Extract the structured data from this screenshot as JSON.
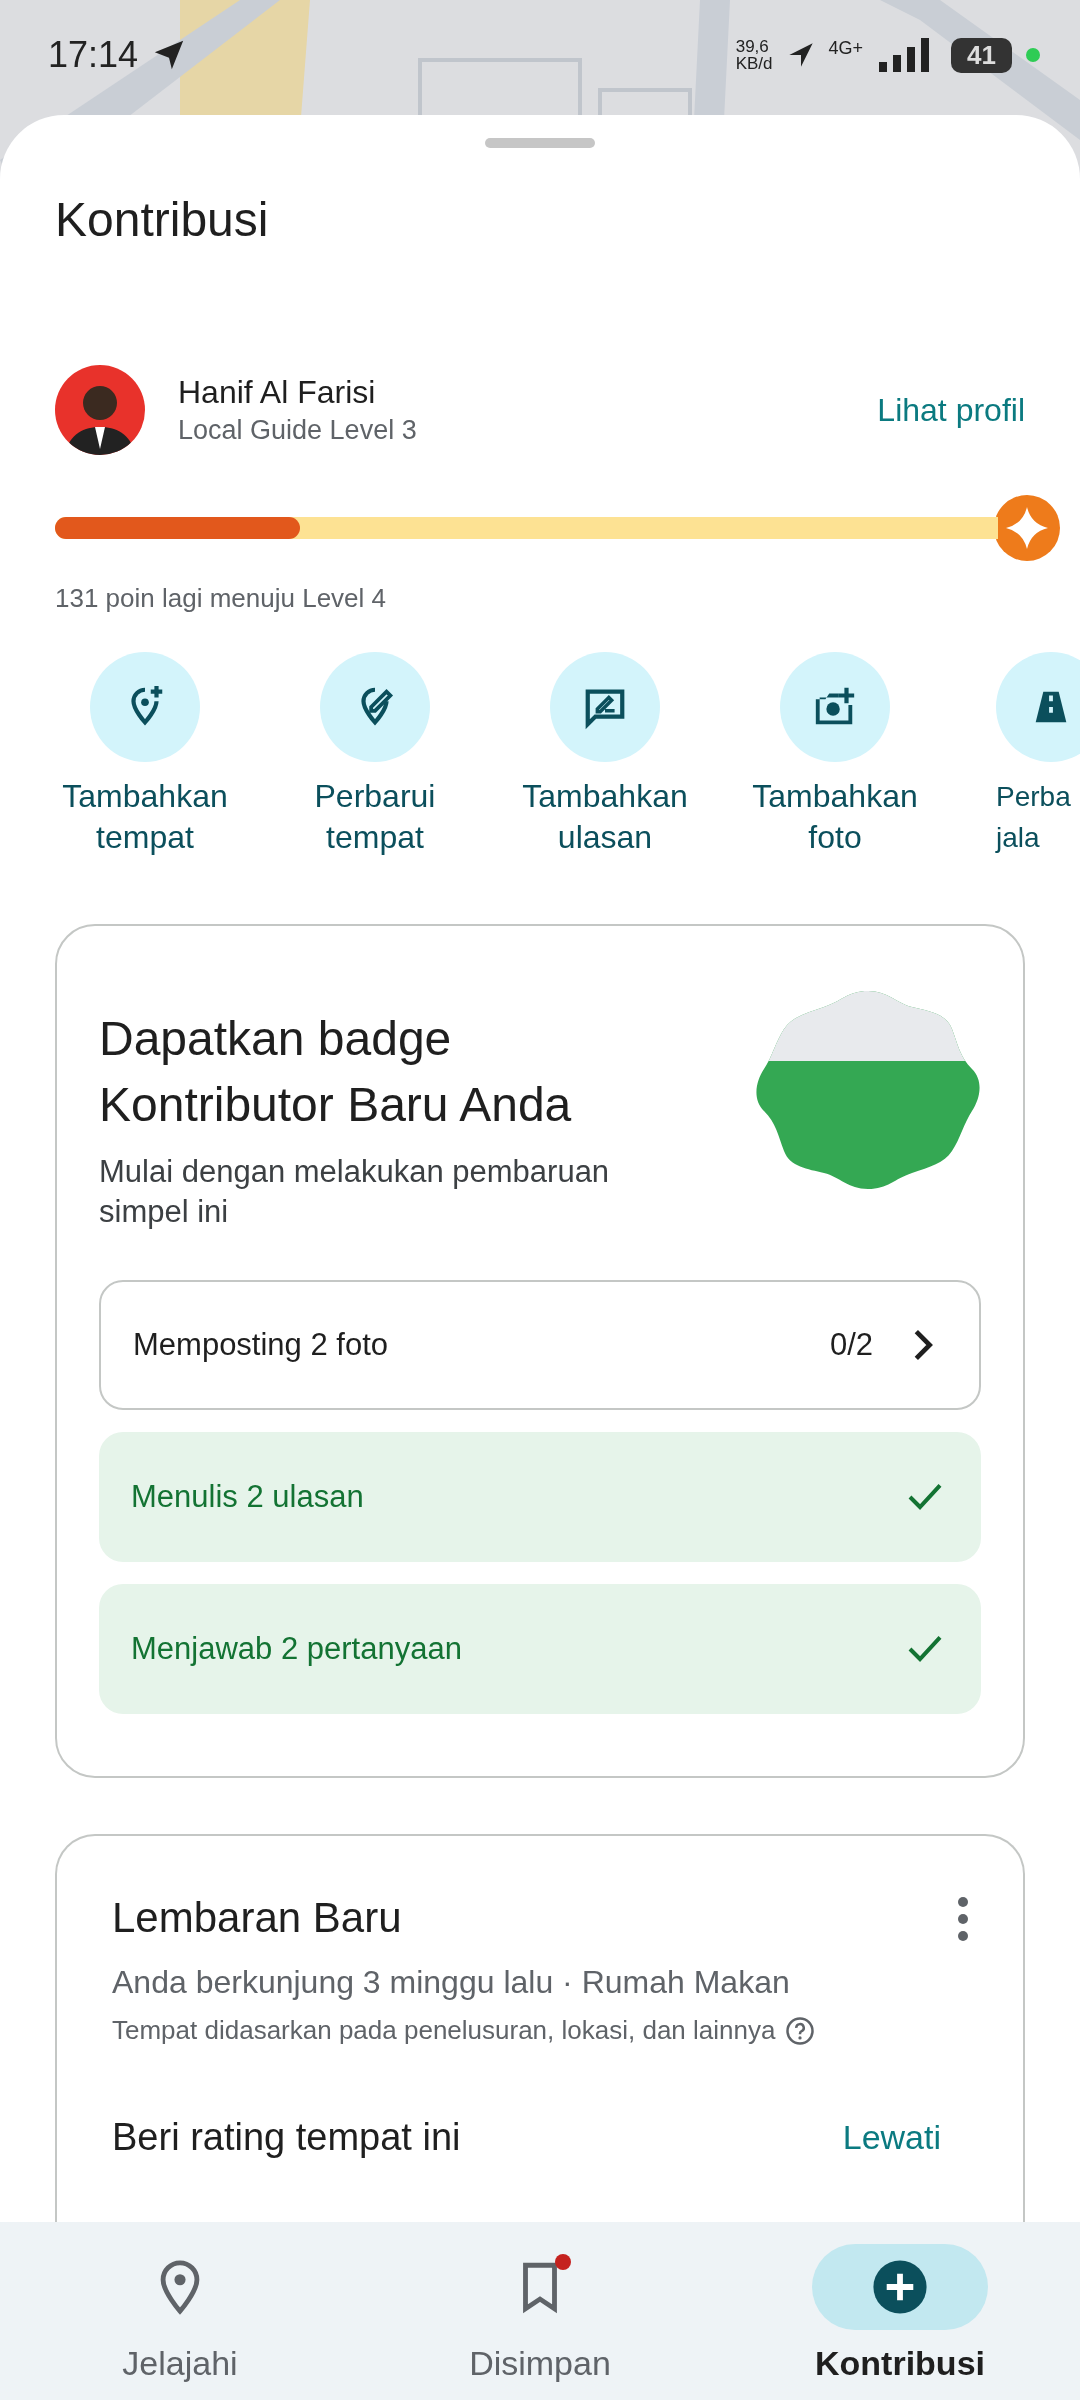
{
  "status_bar": {
    "time": "17:14",
    "net_speed": "39,6",
    "net_unit": "KB/d",
    "network": "4G+",
    "battery": "41"
  },
  "title": "Kontribusi",
  "profile": {
    "name": "Hanif Al Farisi",
    "level_label": "Local Guide Level 3",
    "link": "Lihat profil",
    "progress": {
      "level": 0.26
    },
    "progress_note": "131 poin lagi menuju Level 4"
  },
  "actions": [
    {
      "label": "Tambahkan tempat"
    },
    {
      "label": "Perbarui tempat"
    },
    {
      "label": "Tambahkan ulasan"
    },
    {
      "label": "Tambahkan foto"
    },
    {
      "label": "Perba jala"
    }
  ],
  "badge_card": {
    "title": "Dapatkan badge Kontributor Baru Anda",
    "subtitle": "Mulai dengan melakukan pembaruan simpel ini",
    "tasks": [
      {
        "label": "Memposting 2 foto",
        "count": "0/2",
        "checked": false
      },
      {
        "label": "Menulis 2 ulasan",
        "checked": true
      },
      {
        "label": "Menjawab 2 pertanyaan",
        "checked": true
      }
    ]
  },
  "place_card": {
    "title": "Lembaran Baru",
    "subtitle": "Anda berkunjung 3 minggu lalu · Rumah Makan",
    "note": "Tempat didasarkan pada penelusuran, lokasi, dan lainnya",
    "prompt": "Beri rating tempat ini",
    "skip": "Lewati"
  },
  "nav": [
    {
      "label": "Jelajahi",
      "selected": false,
      "notification": false
    },
    {
      "label": "Disimpan",
      "selected": false,
      "notification": true
    },
    {
      "label": "Kontribusi",
      "selected": true,
      "notification": false
    }
  ]
}
